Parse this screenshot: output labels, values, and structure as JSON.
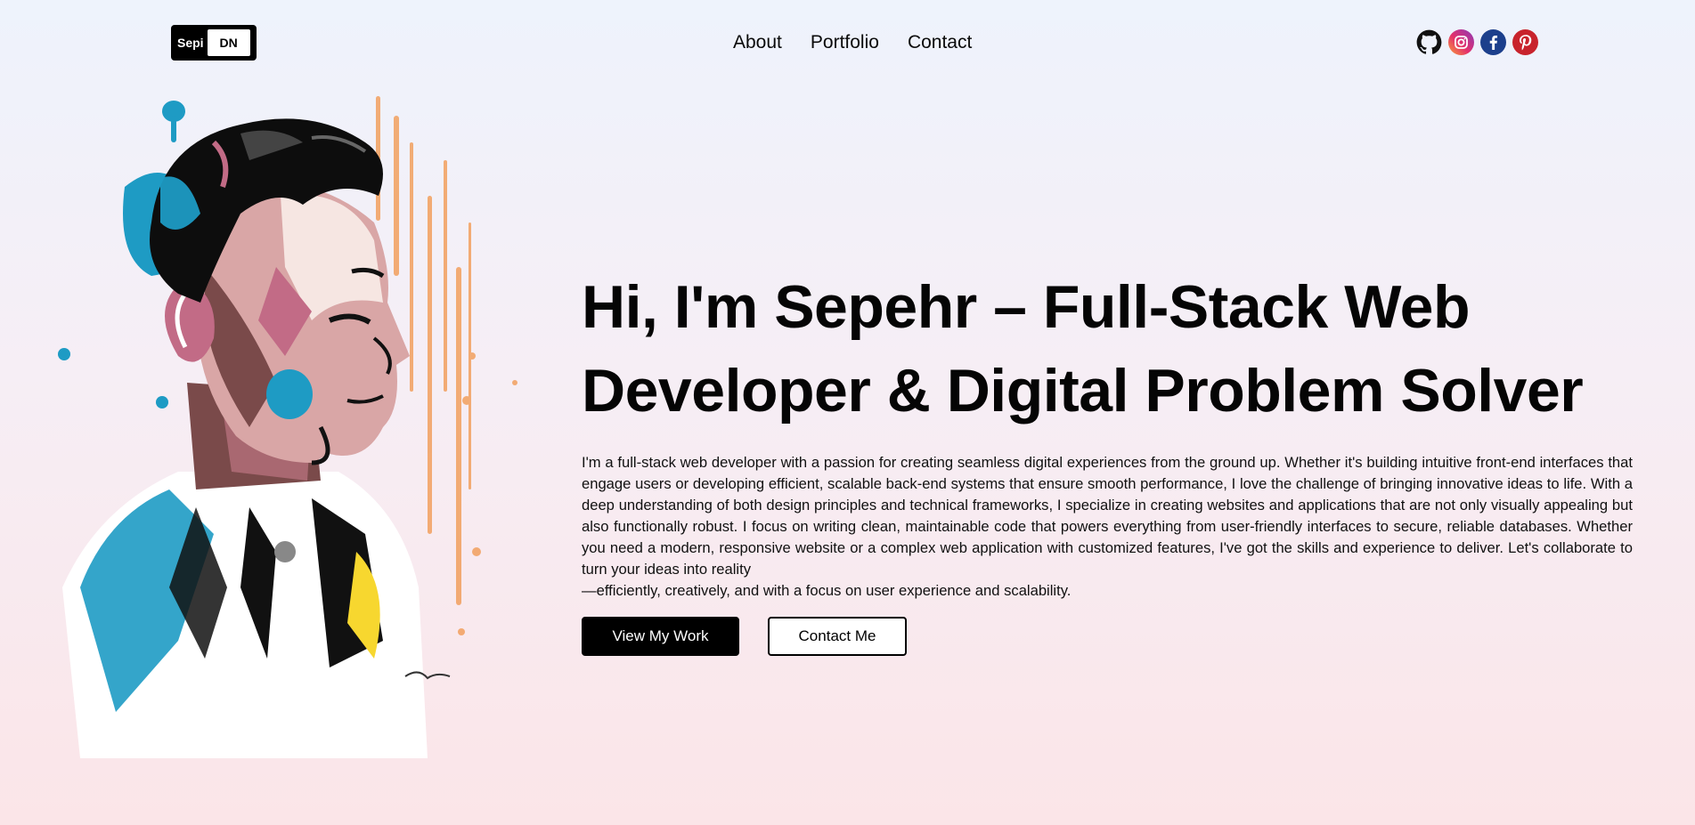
{
  "logo": {
    "left": "Sepi",
    "right": "DN"
  },
  "nav": [
    {
      "label": "About"
    },
    {
      "label": "Portfolio"
    },
    {
      "label": "Contact"
    }
  ],
  "socials": [
    {
      "icon": "github-icon",
      "color": "#111111"
    },
    {
      "icon": "instagram-icon",
      "color": "#c13584"
    },
    {
      "icon": "facebook-icon",
      "color": "#1c3f8c"
    },
    {
      "icon": "pinterest-icon",
      "color": "#c8232c"
    }
  ],
  "hero": {
    "title_line1": "Hi, I'm Sepehr – Full-Stack Web",
    "title_line2": "Developer & Digital Problem Solver",
    "paragraph": "I'm a full-stack web developer with a passion for creating seamless digital experiences from the ground up. Whether it's building intuitive front-end interfaces that engage users or developing efficient, scalable back-end systems that ensure smooth performance, I love the challenge of bringing innovative ideas to life. With a deep understanding of both design principles and technical frameworks, I specialize in creating websites and applications that are not only visually appealing but also functionally robust. I focus on writing clean, maintainable code that powers everything from user-friendly interfaces to secure, reliable databases. Whether you need a modern, responsive website or a complex web application with customized features, I've got the skills and experience to deliver. Let's collaborate to turn your ideas into reality",
    "paragraph_tail": "—efficiently, creatively, and with a focus on user experience and scalability.",
    "primary_button": "View My Work",
    "secondary_button": "Contact Me"
  },
  "portrait": {
    "alt": "illustrated portrait"
  },
  "colors": {
    "accent_blue": "#1e9bc4",
    "accent_pink": "#e0478a",
    "accent_orange": "#f2a05e",
    "accent_yellow": "#f7d72f"
  }
}
